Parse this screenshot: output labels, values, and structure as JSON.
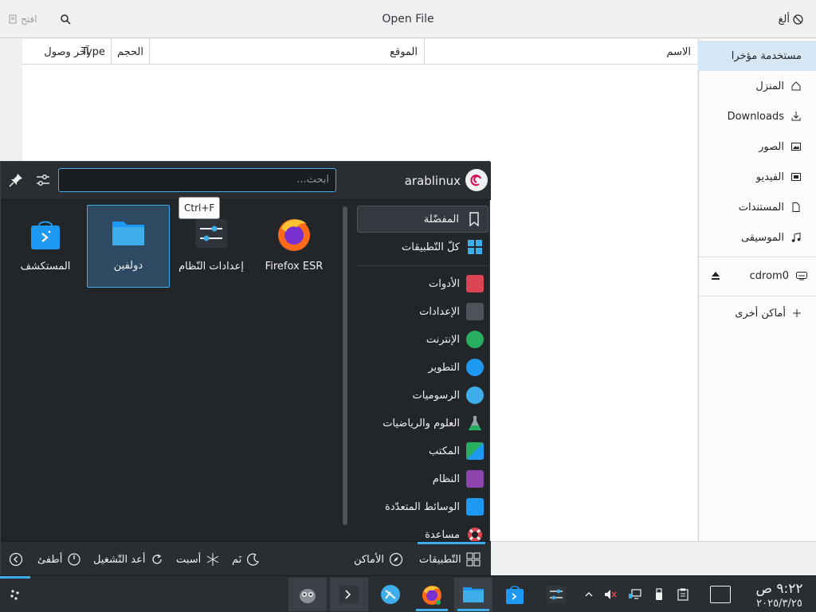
{
  "dialog": {
    "title": "Open File",
    "open_label": "افتح",
    "cancel_label": "ألغ",
    "columns": {
      "name": "الاسم",
      "location": "الموقع",
      "size": "الحجم",
      "type": "Type",
      "last_accessed": "آخر وصول"
    }
  },
  "places": {
    "recent": "مستخدمة مؤخرا",
    "home": "المنزل",
    "downloads": "Downloads",
    "pictures": "الصور",
    "videos": "الفيديو",
    "documents": "المستندات",
    "music": "الموسيقى",
    "cdrom": "cdrom0",
    "other": "أماكن أخرى"
  },
  "launcher": {
    "user": "arablinux",
    "search_placeholder": "ابحث...",
    "tooltip": "Ctrl+F",
    "apps": [
      "Firefox ESR",
      "إعدادات النّظام",
      "دولفين",
      "المستكشف"
    ],
    "categories": [
      "المفضّلة",
      "كلّ التّطبيقات",
      "الأدوات",
      "الإعدادات",
      "الإنترنت",
      "التطوير",
      "الرسوميات",
      "العلوم والرياضيات",
      "المكتب",
      "النظام",
      "الوسائط المتعدّدة",
      "مساعدة"
    ],
    "bottom": {
      "applications": "التّطبيقات",
      "places": "الأماكن",
      "sleep": "نَم",
      "hibernate": "أسبت",
      "restart": "أعد التّشغيل",
      "shutdown": "أطفئ"
    }
  },
  "taskbar": {
    "time": "٩:٢٢ ص",
    "date": "٢٠٢٥/٣/٢٥"
  },
  "colors": {
    "accent": "#3daee9",
    "panel": "#232629",
    "selection": "#d5e6f4"
  }
}
